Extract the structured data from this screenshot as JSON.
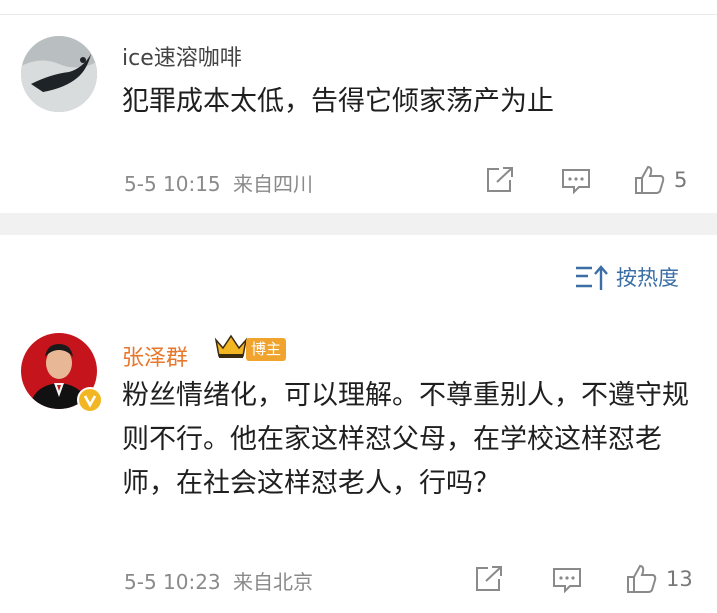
{
  "comments": [
    {
      "username": "ice速溶咖啡",
      "content": "犯罪成本太低，告得它倾家荡产为止",
      "time": "5-5 10:15",
      "location": "来自四川",
      "likes": "5"
    },
    {
      "username": "张泽群",
      "badge": "博主",
      "content": "粉丝情绪化，可以理解。不尊重别人，不遵守规则不行。他在家这样怼父母，在学校这样怼老师，在社会这样怼老人，行吗？",
      "time": "5-5 10:23",
      "location": "来自北京",
      "likes": "13"
    }
  ],
  "sort": {
    "label": "按热度"
  },
  "colors": {
    "author_name": "#e7772b",
    "accent_blue": "#3a6ea5",
    "badge_bg": "#f0a32d",
    "verified": "#f2b623"
  },
  "icons": {
    "share": "share-icon",
    "comment": "comment-icon",
    "like": "thumbs-up-icon",
    "sort": "sort-icon",
    "crown": "crown-icon",
    "verified": "verified-v-icon"
  }
}
